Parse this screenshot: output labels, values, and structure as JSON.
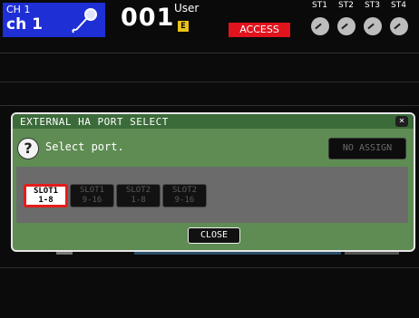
{
  "header": {
    "channel_number": "CH 1",
    "channel_name": "ch 1",
    "scene_number": "001",
    "user": "User",
    "edit_badge": "E",
    "access_label": "ACCESS",
    "stereo_labels": [
      "ST1",
      "ST2",
      "ST3",
      "ST4"
    ],
    "colors": {
      "channel_bg": "#1f2fd6",
      "access_bg": "#e1131d",
      "edit_badge": "#e8c21a"
    }
  },
  "dialog": {
    "title": "EXTERNAL HA PORT SELECT",
    "close_x_label": "×",
    "help_icon": "question-icon",
    "help_icon_glyph": "?",
    "message": "Select port.",
    "no_assign_label": "NO ASSIGN",
    "slots": [
      {
        "line1": "SLOT1",
        "line2": "1-8",
        "selected": true
      },
      {
        "line1": "SLOT1",
        "line2": "9-16",
        "selected": false
      },
      {
        "line1": "SLOT2",
        "line2": "1-8",
        "selected": false
      },
      {
        "line1": "SLOT2",
        "line2": "9-16",
        "selected": false
      }
    ],
    "close_label": "CLOSE",
    "colors": {
      "body": "#5e8c53",
      "title_bar": "#3c6b3a",
      "selected_border": "#e41b1b"
    }
  }
}
